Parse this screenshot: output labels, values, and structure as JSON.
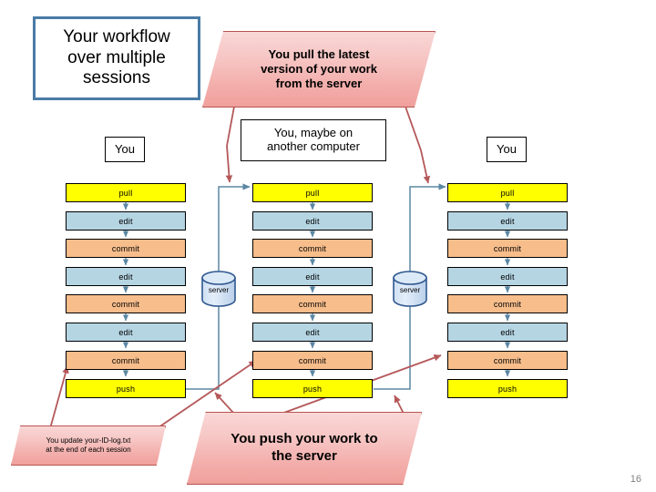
{
  "slide": {
    "page_number": "16",
    "background": "#ffffff"
  },
  "title": {
    "line1": "Your workflow",
    "line2": "over multiple",
    "line3": "sessions",
    "border_color": "#4a7ba6"
  },
  "callouts": {
    "pull": {
      "line1": "You pull the latest",
      "line2": "version of your work",
      "line3": "from the server"
    },
    "log": {
      "line1": "You update your-ID-log.txt",
      "line2": "at the end of each session"
    },
    "push": {
      "line1": "You push your work to",
      "line2": "the server"
    },
    "fill_top": "#f9d7d6",
    "fill_bottom": "#f0a09c",
    "border": "#b85450"
  },
  "labels": {
    "you_left": "You",
    "you_middle_line1": "You, maybe on",
    "you_middle_line2": "another computer",
    "you_right": "You"
  },
  "servers": {
    "left": "server",
    "right": "server",
    "fill": "#c9dcf0",
    "border": "#30588f"
  },
  "columns": [
    {
      "name": "session-1",
      "steps": [
        {
          "label": "pull",
          "kind": "pull"
        },
        {
          "label": "edit",
          "kind": "edit"
        },
        {
          "label": "commit",
          "kind": "commit"
        },
        {
          "label": "edit",
          "kind": "edit"
        },
        {
          "label": "commit",
          "kind": "commit"
        },
        {
          "label": "edit",
          "kind": "edit"
        },
        {
          "label": "commit",
          "kind": "commit"
        },
        {
          "label": "push",
          "kind": "push"
        }
      ]
    },
    {
      "name": "session-2",
      "steps": [
        {
          "label": "pull",
          "kind": "pull"
        },
        {
          "label": "edit",
          "kind": "edit"
        },
        {
          "label": "commit",
          "kind": "commit"
        },
        {
          "label": "edit",
          "kind": "edit"
        },
        {
          "label": "commit",
          "kind": "commit"
        },
        {
          "label": "edit",
          "kind": "edit"
        },
        {
          "label": "commit",
          "kind": "commit"
        },
        {
          "label": "push",
          "kind": "push"
        }
      ]
    },
    {
      "name": "session-3",
      "steps": [
        {
          "label": "pull",
          "kind": "pull"
        },
        {
          "label": "edit",
          "kind": "edit"
        },
        {
          "label": "commit",
          "kind": "commit"
        },
        {
          "label": "edit",
          "kind": "edit"
        },
        {
          "label": "commit",
          "kind": "commit"
        },
        {
          "label": "edit",
          "kind": "edit"
        },
        {
          "label": "commit",
          "kind": "commit"
        },
        {
          "label": "push",
          "kind": "push"
        }
      ]
    }
  ],
  "colors": {
    "step_pull_push": "#ffff00",
    "step_edit": "#b5d5e3",
    "step_commit": "#f7bd8b",
    "connector_blue": "#5b87a3",
    "connector_red": "#b5585a"
  }
}
